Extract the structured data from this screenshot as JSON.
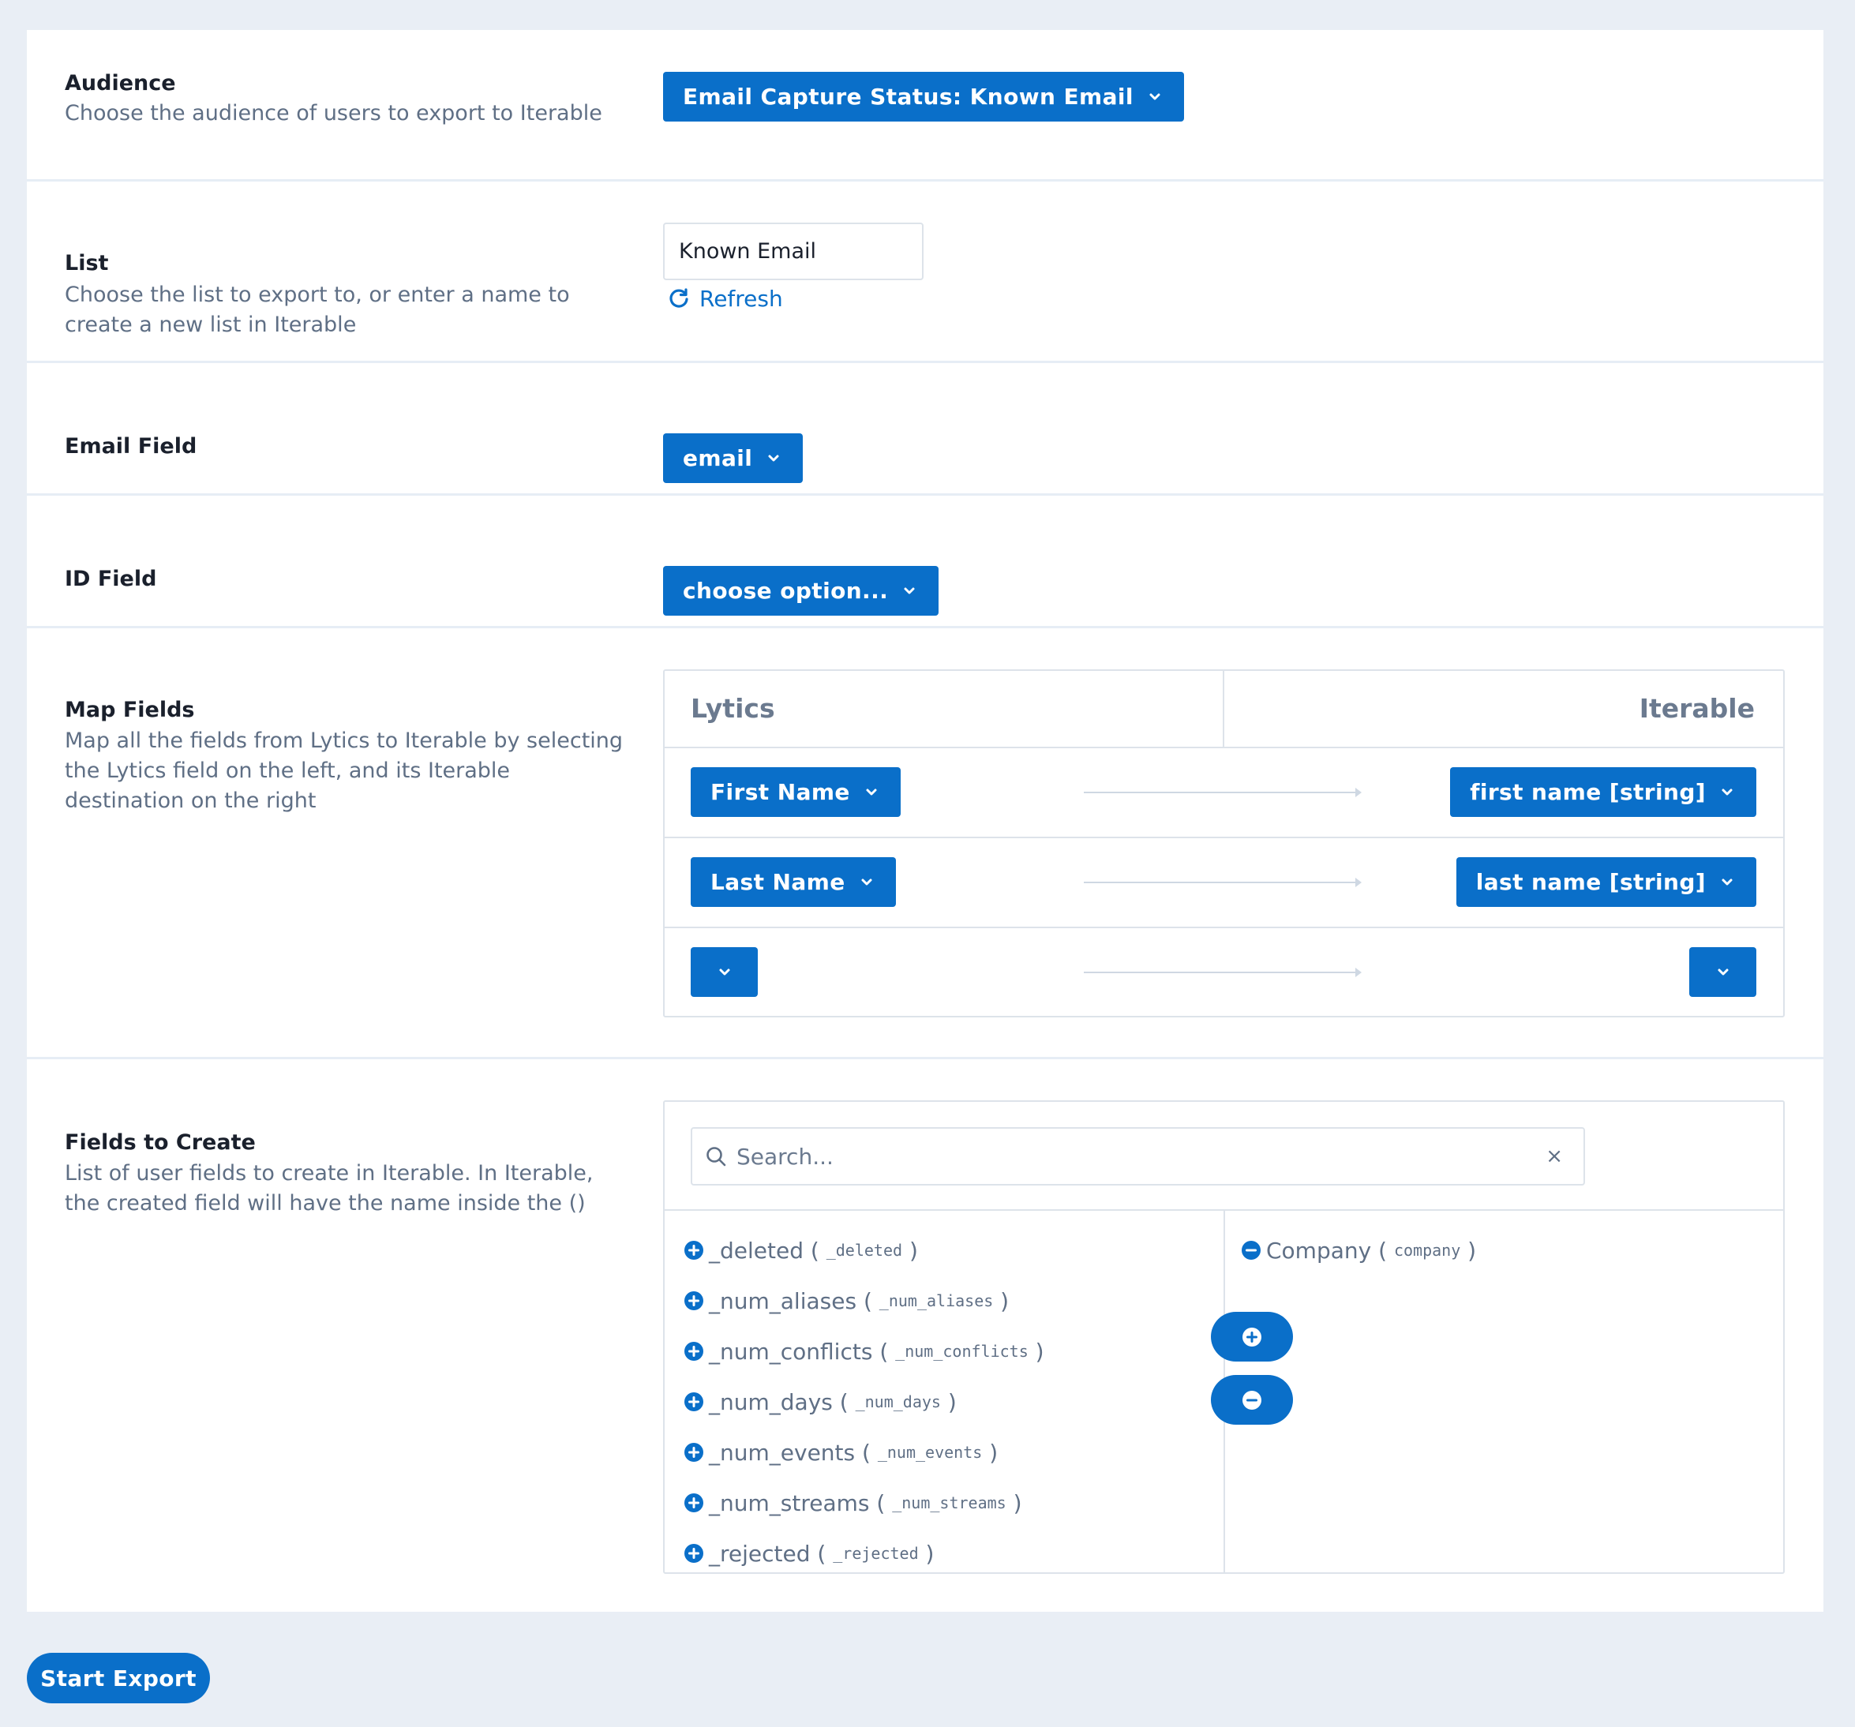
{
  "audience": {
    "title": "Audience",
    "description": "Choose the audience of users to export to Iterable",
    "selected": "Email Capture Status: Known Email"
  },
  "list": {
    "title": "List",
    "description": "Choose the list to export to, or enter a name to create a new list in Iterable",
    "value": "Known Email",
    "refresh_label": "Refresh"
  },
  "email_field": {
    "title": "Email Field",
    "selected": "email"
  },
  "id_field": {
    "title": "ID Field",
    "selected": "choose option..."
  },
  "map_fields": {
    "title": "Map Fields",
    "description": "Map all the fields from Lytics to Iterable by selecting the Lytics field on the left, and its Iterable destination on the right",
    "left_header": "Lytics",
    "right_header": "Iterable",
    "rows": [
      {
        "lytics": "First Name",
        "iterable": "first name [string]"
      },
      {
        "lytics": "Last Name",
        "iterable": "last name [string]"
      },
      {
        "lytics": "",
        "iterable": ""
      }
    ]
  },
  "fields_to_create": {
    "title": "Fields to Create",
    "description": "List of user fields to create in Iterable. In Iterable, the created field will have the name inside the ()",
    "search_placeholder": "Search...",
    "clear_symbol": "×",
    "available": [
      {
        "name": "_deleted",
        "key": "_deleted"
      },
      {
        "name": "_num_aliases",
        "key": "_num_aliases"
      },
      {
        "name": "_num_conflicts",
        "key": "_num_conflicts"
      },
      {
        "name": "_num_days",
        "key": "_num_days"
      },
      {
        "name": "_num_events",
        "key": "_num_events"
      },
      {
        "name": "_num_streams",
        "key": "_num_streams"
      },
      {
        "name": "_rejected",
        "key": "_rejected"
      }
    ],
    "selected": [
      {
        "name": "Company",
        "key": "company"
      }
    ]
  },
  "start_export_label": "Start Export",
  "colors": {
    "accent": "#0a6fc9",
    "background": "#e9eef5",
    "muted_text": "#5f6f85"
  }
}
